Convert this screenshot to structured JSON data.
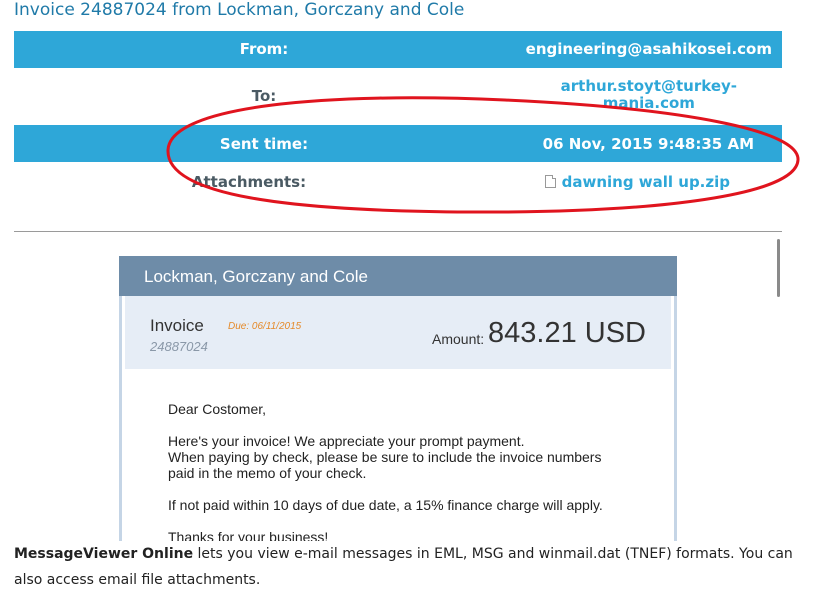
{
  "title": "Invoice 24887024 from Lockman, Gorczany and Cole",
  "headers": {
    "from_label": "From:",
    "from_value": "engineering@asahikosei.com",
    "to_label": "To:",
    "to_value_line1": "arthur.stoyt@turkey-",
    "to_value_line2": "mania.com",
    "sent_label": "Sent time:",
    "sent_value": "06 Nov, 2015 9:48:35 AM",
    "attach_label": "Attachments:",
    "attach_value": "dawning wall up.zip",
    "attach_icon": "file-icon"
  },
  "colors": {
    "header_blue": "#2ea7d8",
    "annotation_red": "#e0141e",
    "company_bar": "#6e8ca8"
  },
  "invoice": {
    "company": "Lockman, Gorczany and Cole",
    "word": "Invoice",
    "due": "Due: 06/11/2015",
    "number": "24887024",
    "amount_label": "Amount:",
    "amount_value": "843.21 USD",
    "greeting": "Dear Costomer,",
    "para1_line1": "Here's your invoice! We appreciate your prompt payment.",
    "para1_line2": "When paying by check, please be sure to include the invoice numbers",
    "para1_line3": "paid in the memo of your check.",
    "para2": "If not paid within 10 days of due date, a 15% finance charge will apply.",
    "para3_partial": "Thanks for your business!"
  },
  "footer": {
    "brand": "MessageViewer Online",
    "text": " lets you view e-mail messages in EML, MSG and winmail.dat (TNEF) formats. You can also access email file attachments."
  }
}
